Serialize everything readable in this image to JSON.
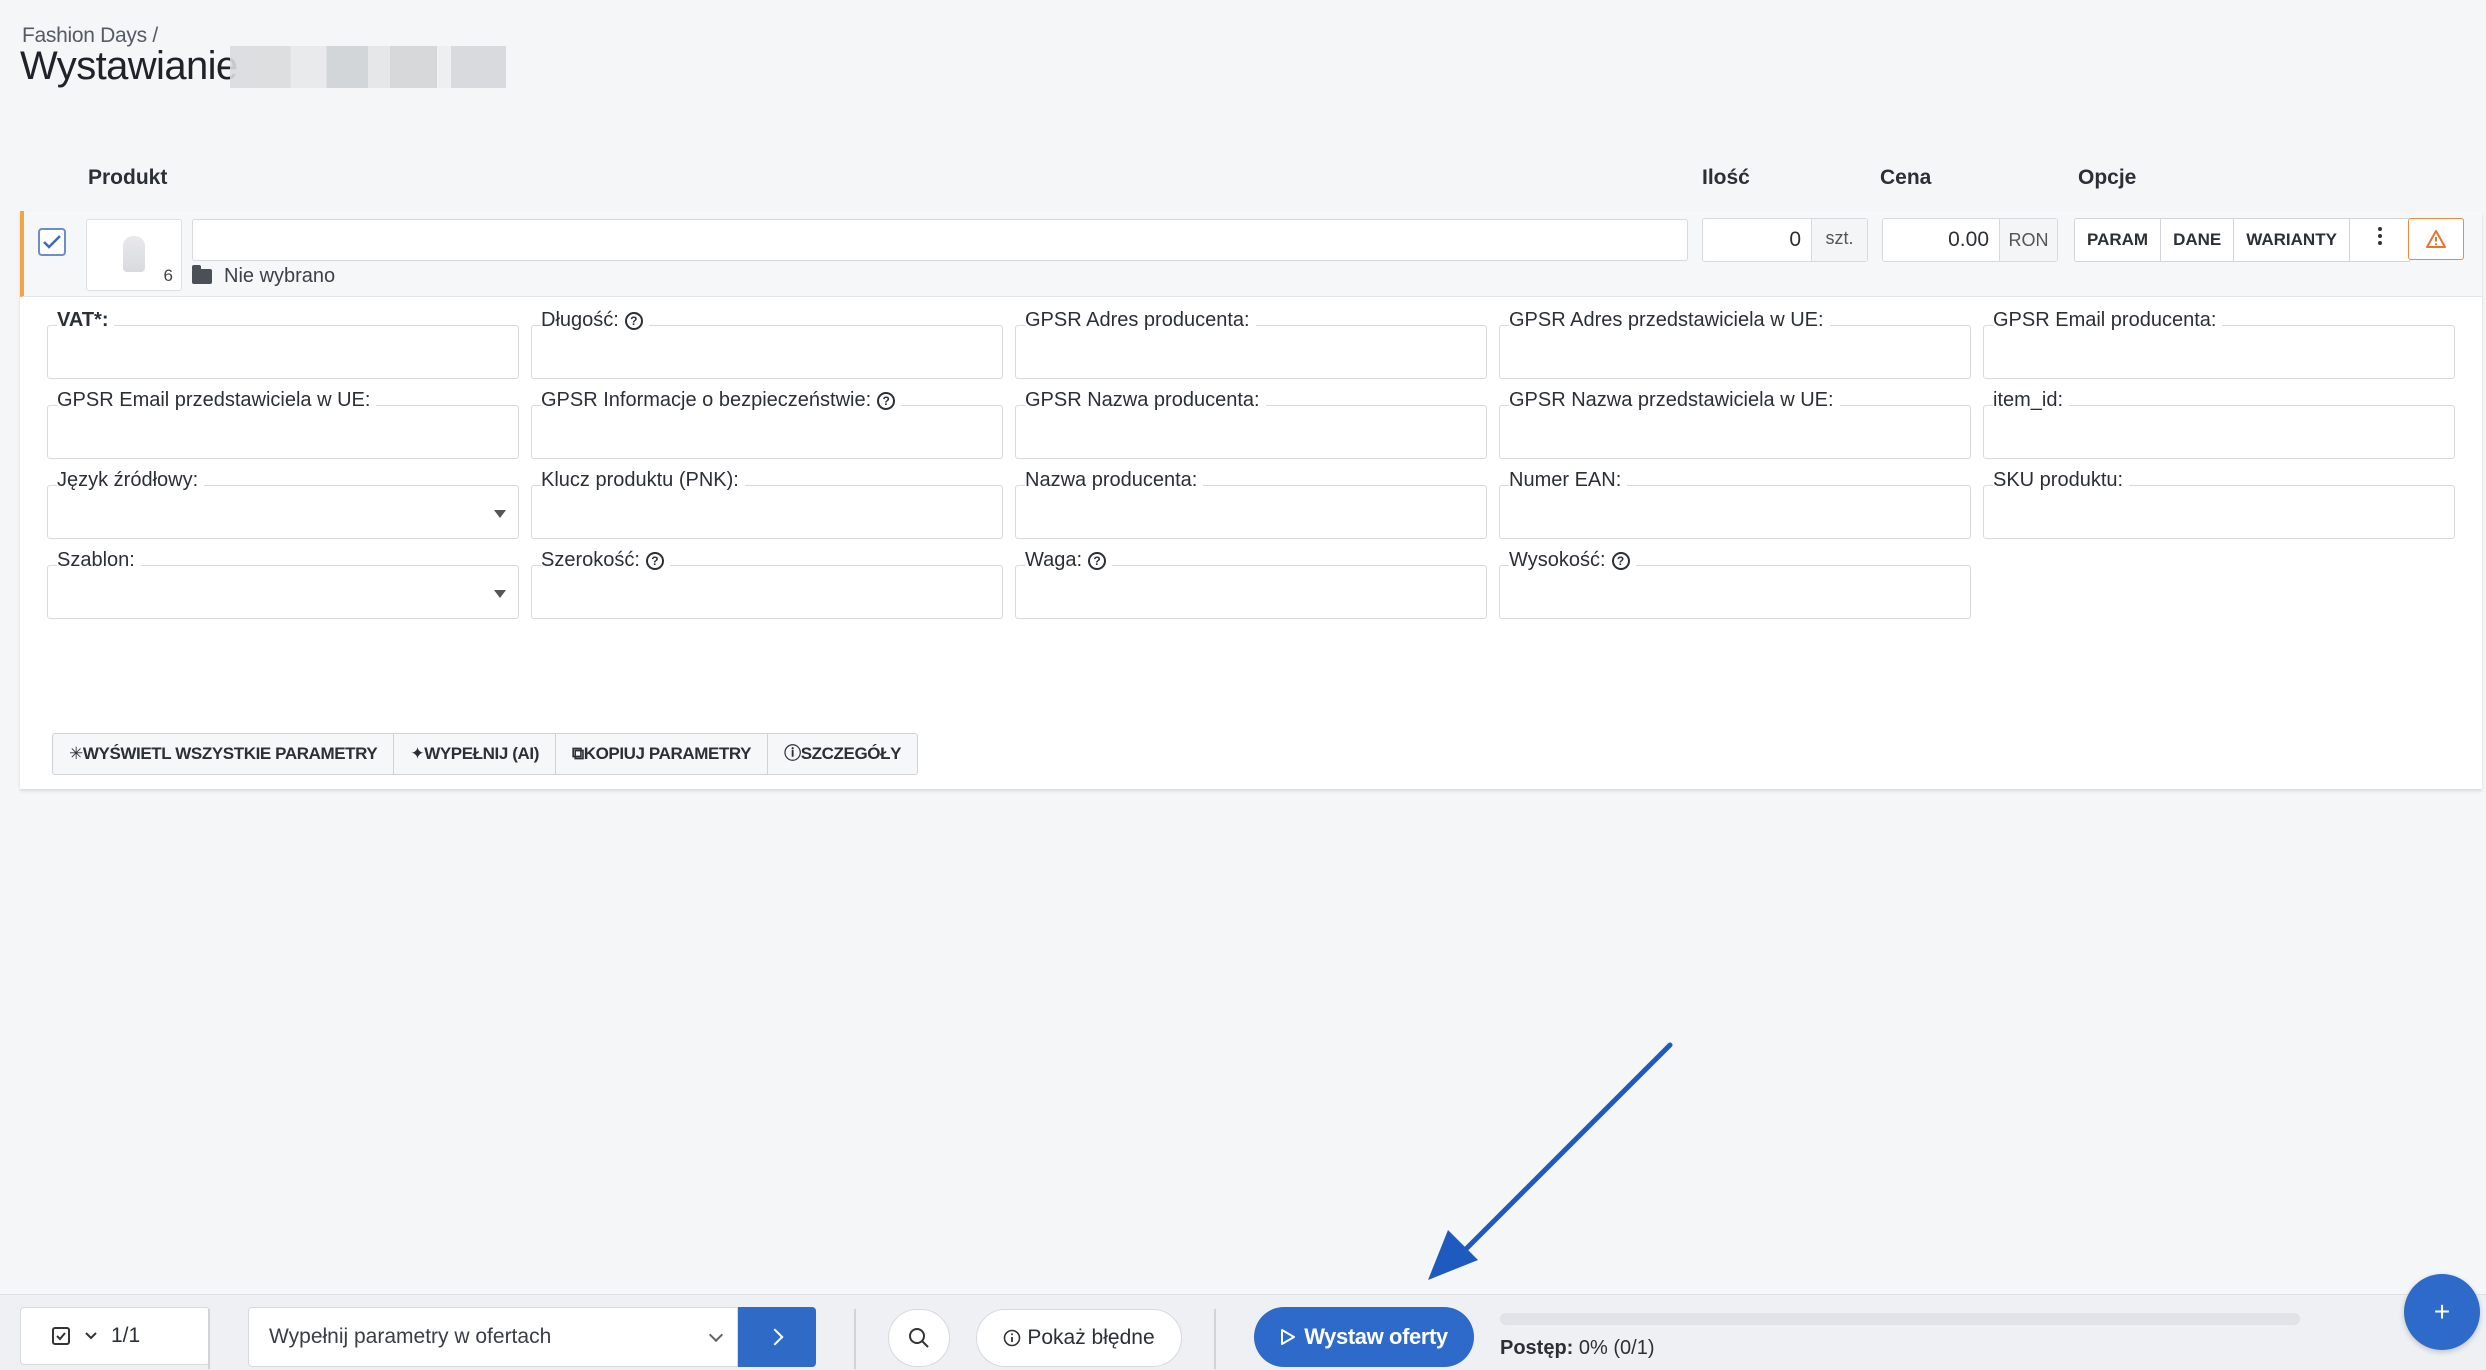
{
  "header": {
    "breadcrumb": "Fashion Days /",
    "title": "Wystawianie"
  },
  "columns": {
    "product": "Produkt",
    "quantity": "Ilość",
    "price": "Cena",
    "options": "Opcje"
  },
  "product_row": {
    "checked": true,
    "image_count": "6",
    "name_value": "",
    "category": "Nie wybrano",
    "quantity": "0",
    "quantity_unit": "szt.",
    "price": "0.00",
    "currency": "RON",
    "option_buttons": [
      "PARAM",
      "DANE",
      "WARIANTY"
    ],
    "more_icon": "more-vertical-icon",
    "warning_icon": "warning-triangle-icon"
  },
  "parameters": [
    {
      "label": "VAT*:",
      "required": true,
      "help": false,
      "type": "text"
    },
    {
      "label": "Długość:",
      "required": false,
      "help": true,
      "type": "text"
    },
    {
      "label": "GPSR Adres producenta:",
      "required": false,
      "help": false,
      "type": "text"
    },
    {
      "label": "GPSR Adres przedstawiciela w UE:",
      "required": false,
      "help": false,
      "type": "text"
    },
    {
      "label": "GPSR Email producenta:",
      "required": false,
      "help": false,
      "type": "text"
    },
    {
      "label": "GPSR Email przedstawiciela w UE:",
      "required": false,
      "help": false,
      "type": "text"
    },
    {
      "label": "GPSR Informacje o bezpieczeństwie:",
      "required": false,
      "help": true,
      "type": "text"
    },
    {
      "label": "GPSR Nazwa producenta:",
      "required": false,
      "help": false,
      "type": "text"
    },
    {
      "label": "GPSR Nazwa przedstawiciela w UE:",
      "required": false,
      "help": false,
      "type": "text"
    },
    {
      "label": "item_id:",
      "required": false,
      "help": false,
      "type": "text"
    },
    {
      "label": "Język źródłowy:",
      "required": false,
      "help": false,
      "type": "select"
    },
    {
      "label": "Klucz produktu (PNK):",
      "required": false,
      "help": false,
      "type": "text"
    },
    {
      "label": "Nazwa producenta:",
      "required": false,
      "help": false,
      "type": "text"
    },
    {
      "label": "Numer EAN:",
      "required": false,
      "help": false,
      "type": "text"
    },
    {
      "label": "SKU produktu:",
      "required": false,
      "help": false,
      "type": "text"
    },
    {
      "label": "Szablon:",
      "required": false,
      "help": false,
      "type": "select"
    },
    {
      "label": "Szerokość:",
      "required": false,
      "help": true,
      "type": "text"
    },
    {
      "label": "Waga:",
      "required": false,
      "help": true,
      "type": "text"
    },
    {
      "label": "Wysokość:",
      "required": false,
      "help": true,
      "type": "text"
    }
  ],
  "parameter_actions": [
    {
      "label": "WYŚWIETL WSZYSTKIE PARAMETRY",
      "icon": "asterisk-icon"
    },
    {
      "label": "WYPEŁNIJ (AI)",
      "icon": "sparkles-icon"
    },
    {
      "label": "KOPIUJ PARAMETRY",
      "icon": "copy-icon"
    },
    {
      "label": "SZCZEGÓŁY",
      "icon": "info-icon"
    }
  ],
  "bottom_bar": {
    "selected_count": "1/1",
    "bulk_action": "Wypełnij parametry w ofertach",
    "show_errors_label": "Pokaż błędne",
    "publish_label": "Wystaw oferty",
    "progress_label": "Postęp:",
    "progress_value": "0% (0/1)",
    "progress_fraction": 0.0
  },
  "colors": {
    "accent": "#2e6ac9",
    "row_marker": "#f0a646",
    "warning": "#f08a3c",
    "annotation_arrow": "#1f5bbf"
  }
}
